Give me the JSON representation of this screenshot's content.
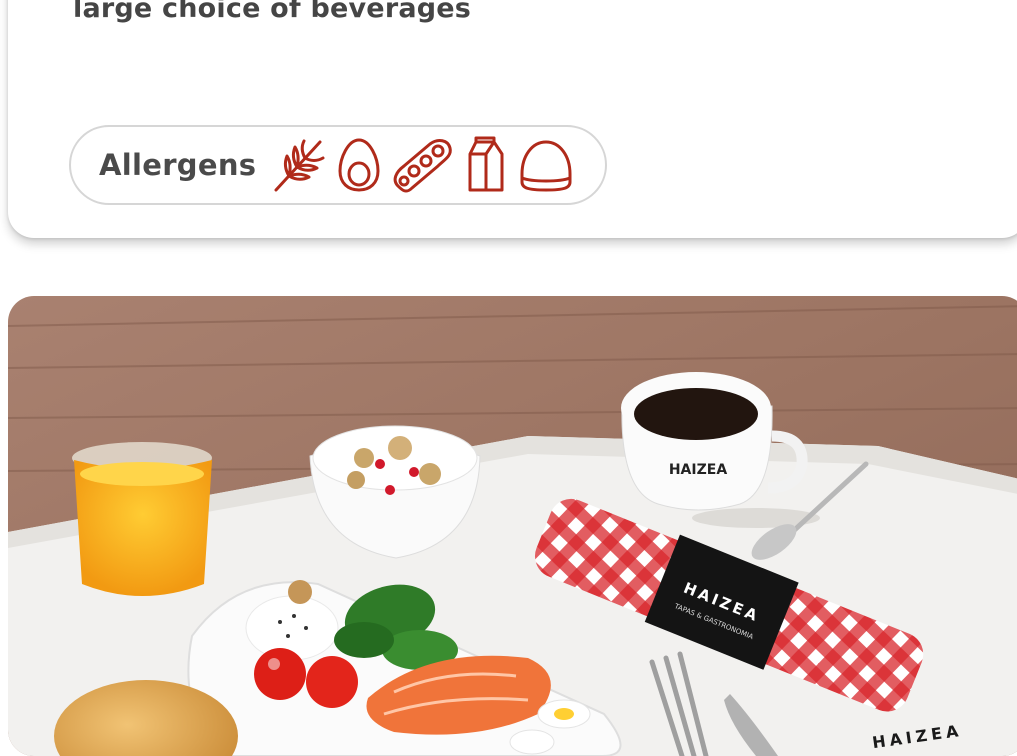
{
  "dish": {
    "description": "large choice of beverages"
  },
  "allergens": {
    "label": "Allergens",
    "icons": [
      "wheat-icon",
      "egg-icon",
      "soy-icon",
      "milk-icon",
      "nuts-icon"
    ],
    "icon_color": "#b02a1a"
  },
  "photo": {
    "branding": [
      "HAIZEA",
      "TAPAS & GASTRONOMIA"
    ]
  }
}
